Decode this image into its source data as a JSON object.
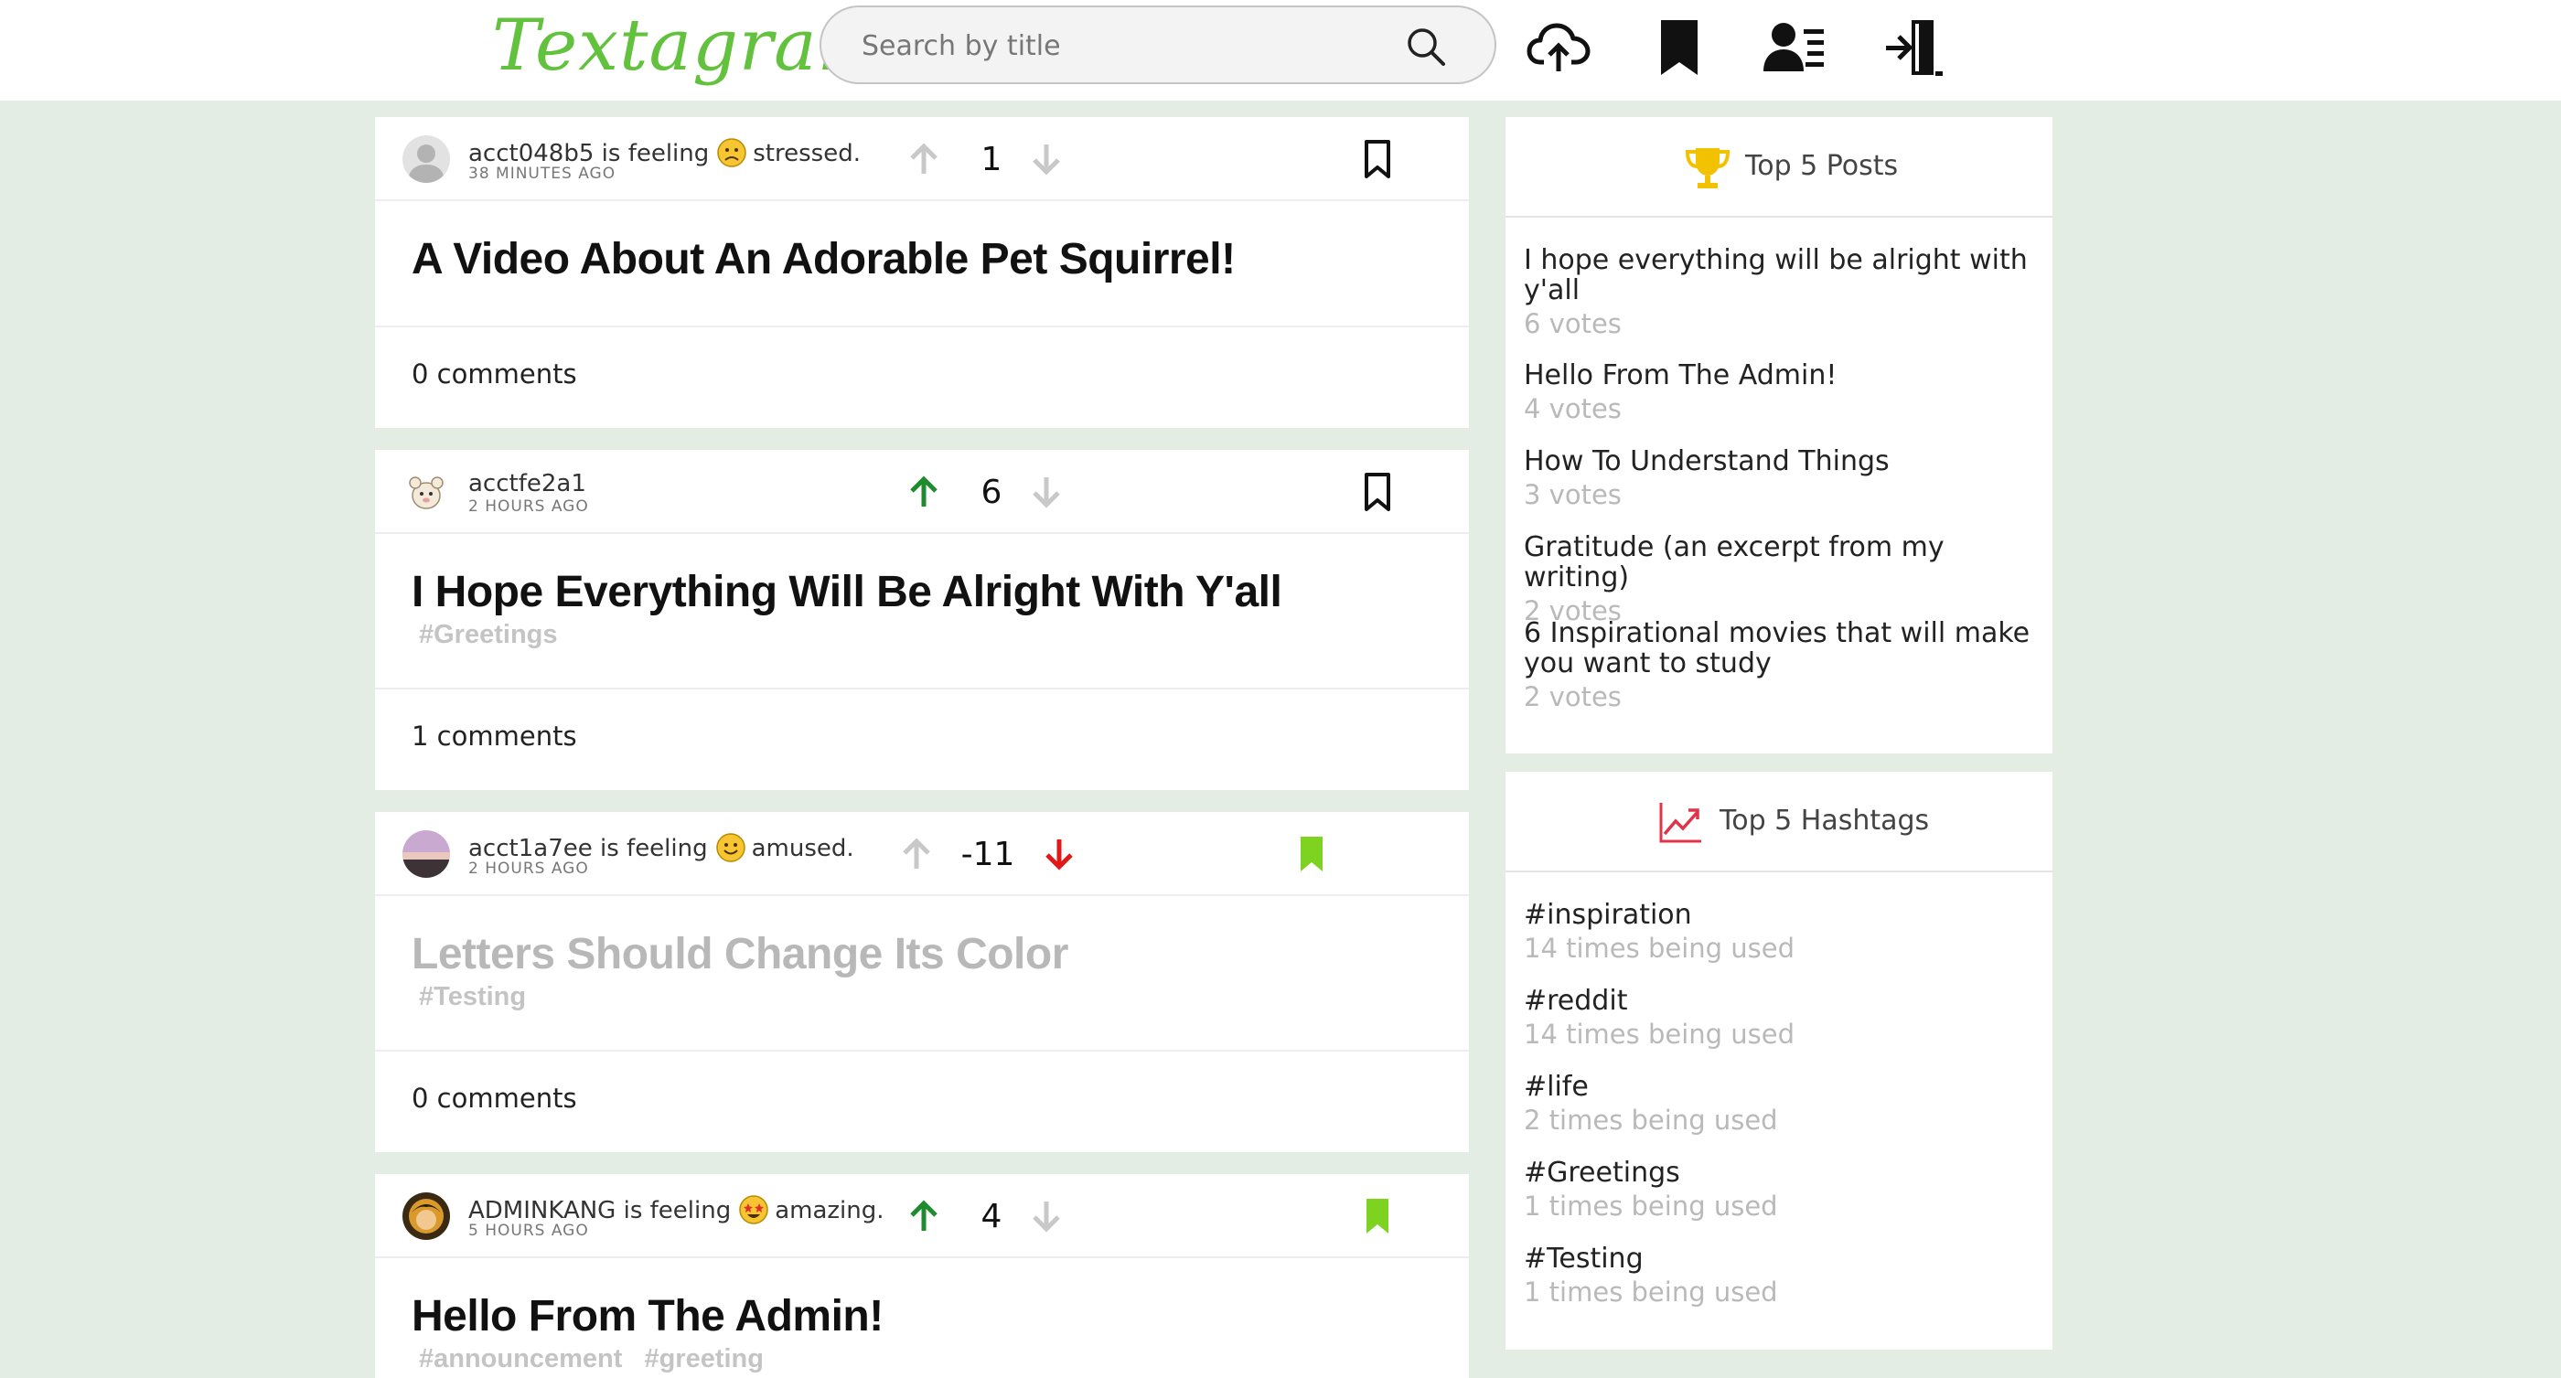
{
  "header": {
    "logo": "Textagram",
    "search_placeholder": "Search by title",
    "icons": [
      "search-icon",
      "upload-cloud-icon",
      "bookmark-icon",
      "profile-icon",
      "logout-icon"
    ]
  },
  "posts": [
    {
      "author": "acct048b5",
      "feeling_prefix": "is feeling",
      "mood": "stressed.",
      "mood_icon": "worried-face-emoji",
      "time": "38 MINUTES AGO",
      "score": "1",
      "vote_state": "none",
      "bookmarked": false,
      "title": "A Video About An Adorable Pet Squirrel!",
      "tags": [],
      "comments": "0 comments"
    },
    {
      "author": "acctfe2a1",
      "feeling_prefix": "",
      "mood": "",
      "time": "2 HOURS AGO",
      "score": "6",
      "vote_state": "up",
      "bookmarked": false,
      "title": "I Hope Everything Will Be Alright With Y'all",
      "tags": [
        "#Greetings"
      ],
      "comments": "1 comments"
    },
    {
      "author": "acct1a7ee",
      "feeling_prefix": "is feeling",
      "mood": "amused.",
      "mood_icon": "slightly-smiling-face-emoji",
      "time": "2 HOURS AGO",
      "score": "-11",
      "vote_state": "down",
      "bookmarked": true,
      "title": "Letters Should Change Its Color",
      "tags": [
        "#Testing"
      ],
      "comments": "0 comments"
    },
    {
      "author": "ADMINKANG",
      "feeling_prefix": "is feeling",
      "mood": "amazing.",
      "mood_icon": "star-struck-face-emoji",
      "time": "5 HOURS AGO",
      "score": "4",
      "vote_state": "up",
      "bookmarked": true,
      "title": "Hello From The Admin!",
      "tags": [
        "#announcement",
        "#greeting"
      ],
      "comments": ""
    }
  ],
  "top_posts": {
    "title": "Top 5 Posts",
    "items": [
      {
        "name": "I hope everything will be alright with y'all",
        "votes": "6 votes"
      },
      {
        "name": "Hello From The Admin!",
        "votes": "4 votes"
      },
      {
        "name": "How To Understand Things",
        "votes": "3 votes"
      },
      {
        "name": "Gratitude (an excerpt from my writing)",
        "votes": "2 votes"
      },
      {
        "name": "6 Inspirational movies that will make you want to study",
        "votes": "2 votes"
      }
    ]
  },
  "top_hashtags": {
    "title": "Top 5 Hashtags",
    "items": [
      {
        "name": "#inspiration",
        "usage": "14 times being used"
      },
      {
        "name": "#reddit",
        "usage": "14 times being used"
      },
      {
        "name": "#life",
        "usage": "2 times being used"
      },
      {
        "name": "#Greetings",
        "usage": "1 times being used"
      },
      {
        "name": "#Testing",
        "usage": "1 times being used"
      }
    ]
  },
  "colors": {
    "background": "#e3ede4",
    "logo_green": "#63c23d",
    "upvote_active": "#1e8c2e",
    "downvote_active": "#e01818",
    "vote_inactive": "#c8c8c8",
    "bookmark_active": "#7ed321",
    "trophy": "#f2c200",
    "trend": "#e0344a"
  }
}
